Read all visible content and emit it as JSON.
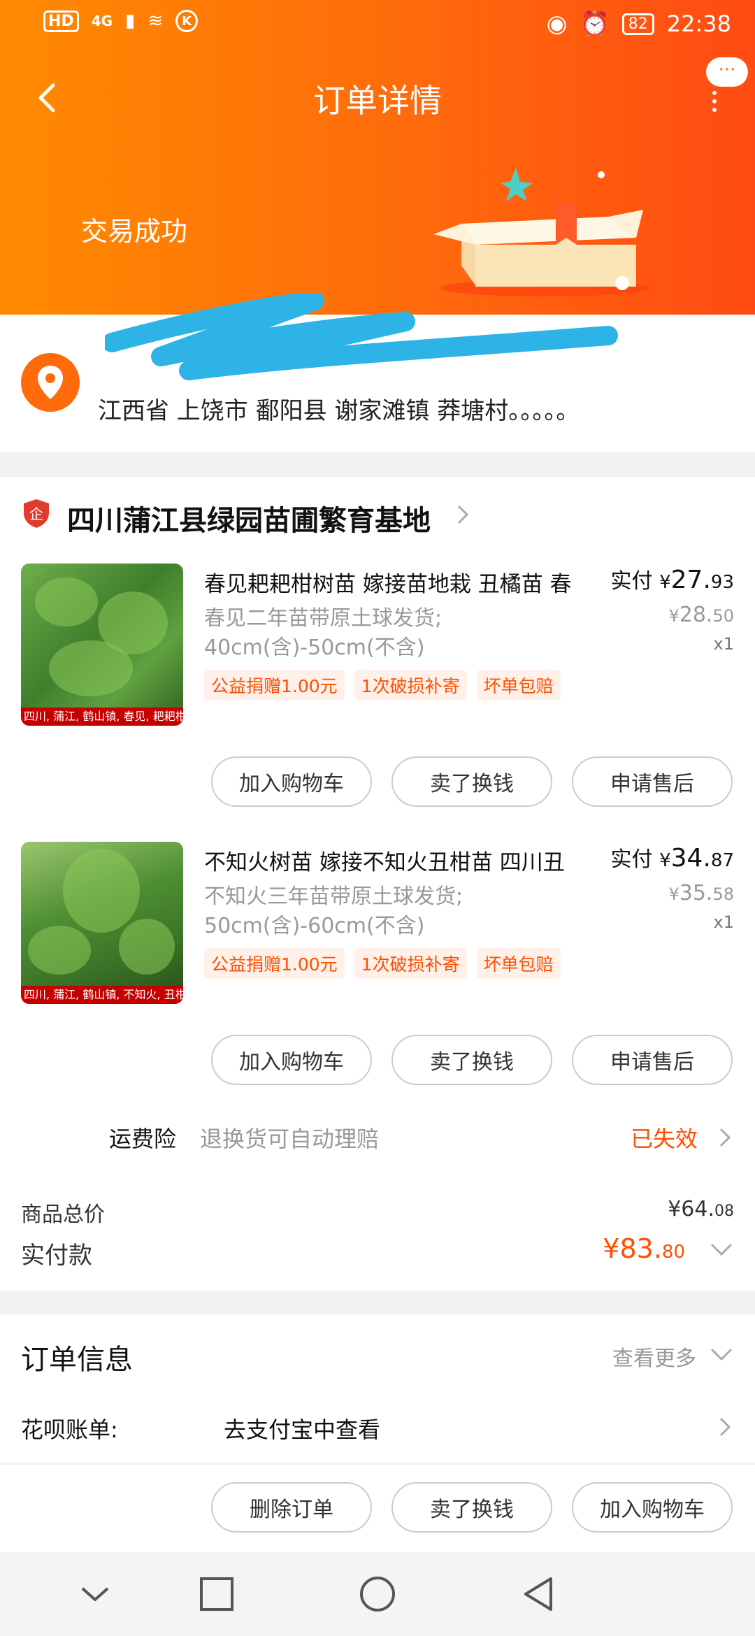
{
  "status_bar": {
    "signal": "HD",
    "network": "4G",
    "battery": "82",
    "time": "22:38"
  },
  "header": {
    "title": "订单详情",
    "more_label": "···",
    "order_status": "交易成功"
  },
  "address": {
    "name": "",
    "line": "江西省 上饶市 鄱阳县 谢家滩镇 莽塘村。。。。。"
  },
  "shop": {
    "name": "四川蒲江县绿园苗圃繁育基地"
  },
  "items": [
    {
      "thumb_caption": "四川, 蒲江, 鹤山镇, 春见, 耙耙柑, 直销",
      "title": "春见耙耙柑树苗 嫁接苗地栽 丑橘苗 春",
      "sku_line1": "春见二年苗带原土球发货;",
      "sku_line2": "40cm(含)-50cm(不含)",
      "tags": [
        "公益捐赠1.00元",
        "1次破损补寄",
        "坏单包赔"
      ],
      "paid_label": "实付",
      "currency": "¥",
      "paid_int": "27.",
      "paid_dec": "93",
      "orig_int": "28.",
      "orig_dec": "50",
      "qty": "x1",
      "buttons": [
        "加入购物车",
        "卖了换钱",
        "申请售后"
      ]
    },
    {
      "thumb_caption": "四川, 蒲江, 鹤山镇, 不知火, 丑柑, 直销",
      "title": "不知火树苗 嫁接不知火丑柑苗 四川丑",
      "sku_line1": "不知火三年苗带原土球发货;",
      "sku_line2": "50cm(含)-60cm(不含)",
      "tags": [
        "公益捐赠1.00元",
        "1次破损补寄",
        "坏单包赔"
      ],
      "paid_label": "实付",
      "currency": "¥",
      "paid_int": "34.",
      "paid_dec": "87",
      "orig_int": "35.",
      "orig_dec": "58",
      "qty": "x1",
      "buttons": [
        "加入购物车",
        "卖了换钱",
        "申请售后"
      ]
    }
  ],
  "shipping_insurance": {
    "label": "运费险",
    "desc": "退换货可自动理赔",
    "status": "已失效"
  },
  "totals": {
    "goods_label": "商品总价",
    "goods_int": "¥64.",
    "goods_dec": "08",
    "payable_label": "实付款",
    "payable_int": "¥83.",
    "payable_dec": "80"
  },
  "order_info": {
    "title": "订单信息",
    "more": "查看更多",
    "huabei_label": "花呗账单:",
    "huabei_value": "去支付宝中查看"
  },
  "actions": [
    "删除订单",
    "卖了换钱",
    "加入购物车"
  ],
  "colors": {
    "accent": "#ff5000",
    "header_start": "#ff8a00",
    "header_end": "#ff4b13"
  }
}
